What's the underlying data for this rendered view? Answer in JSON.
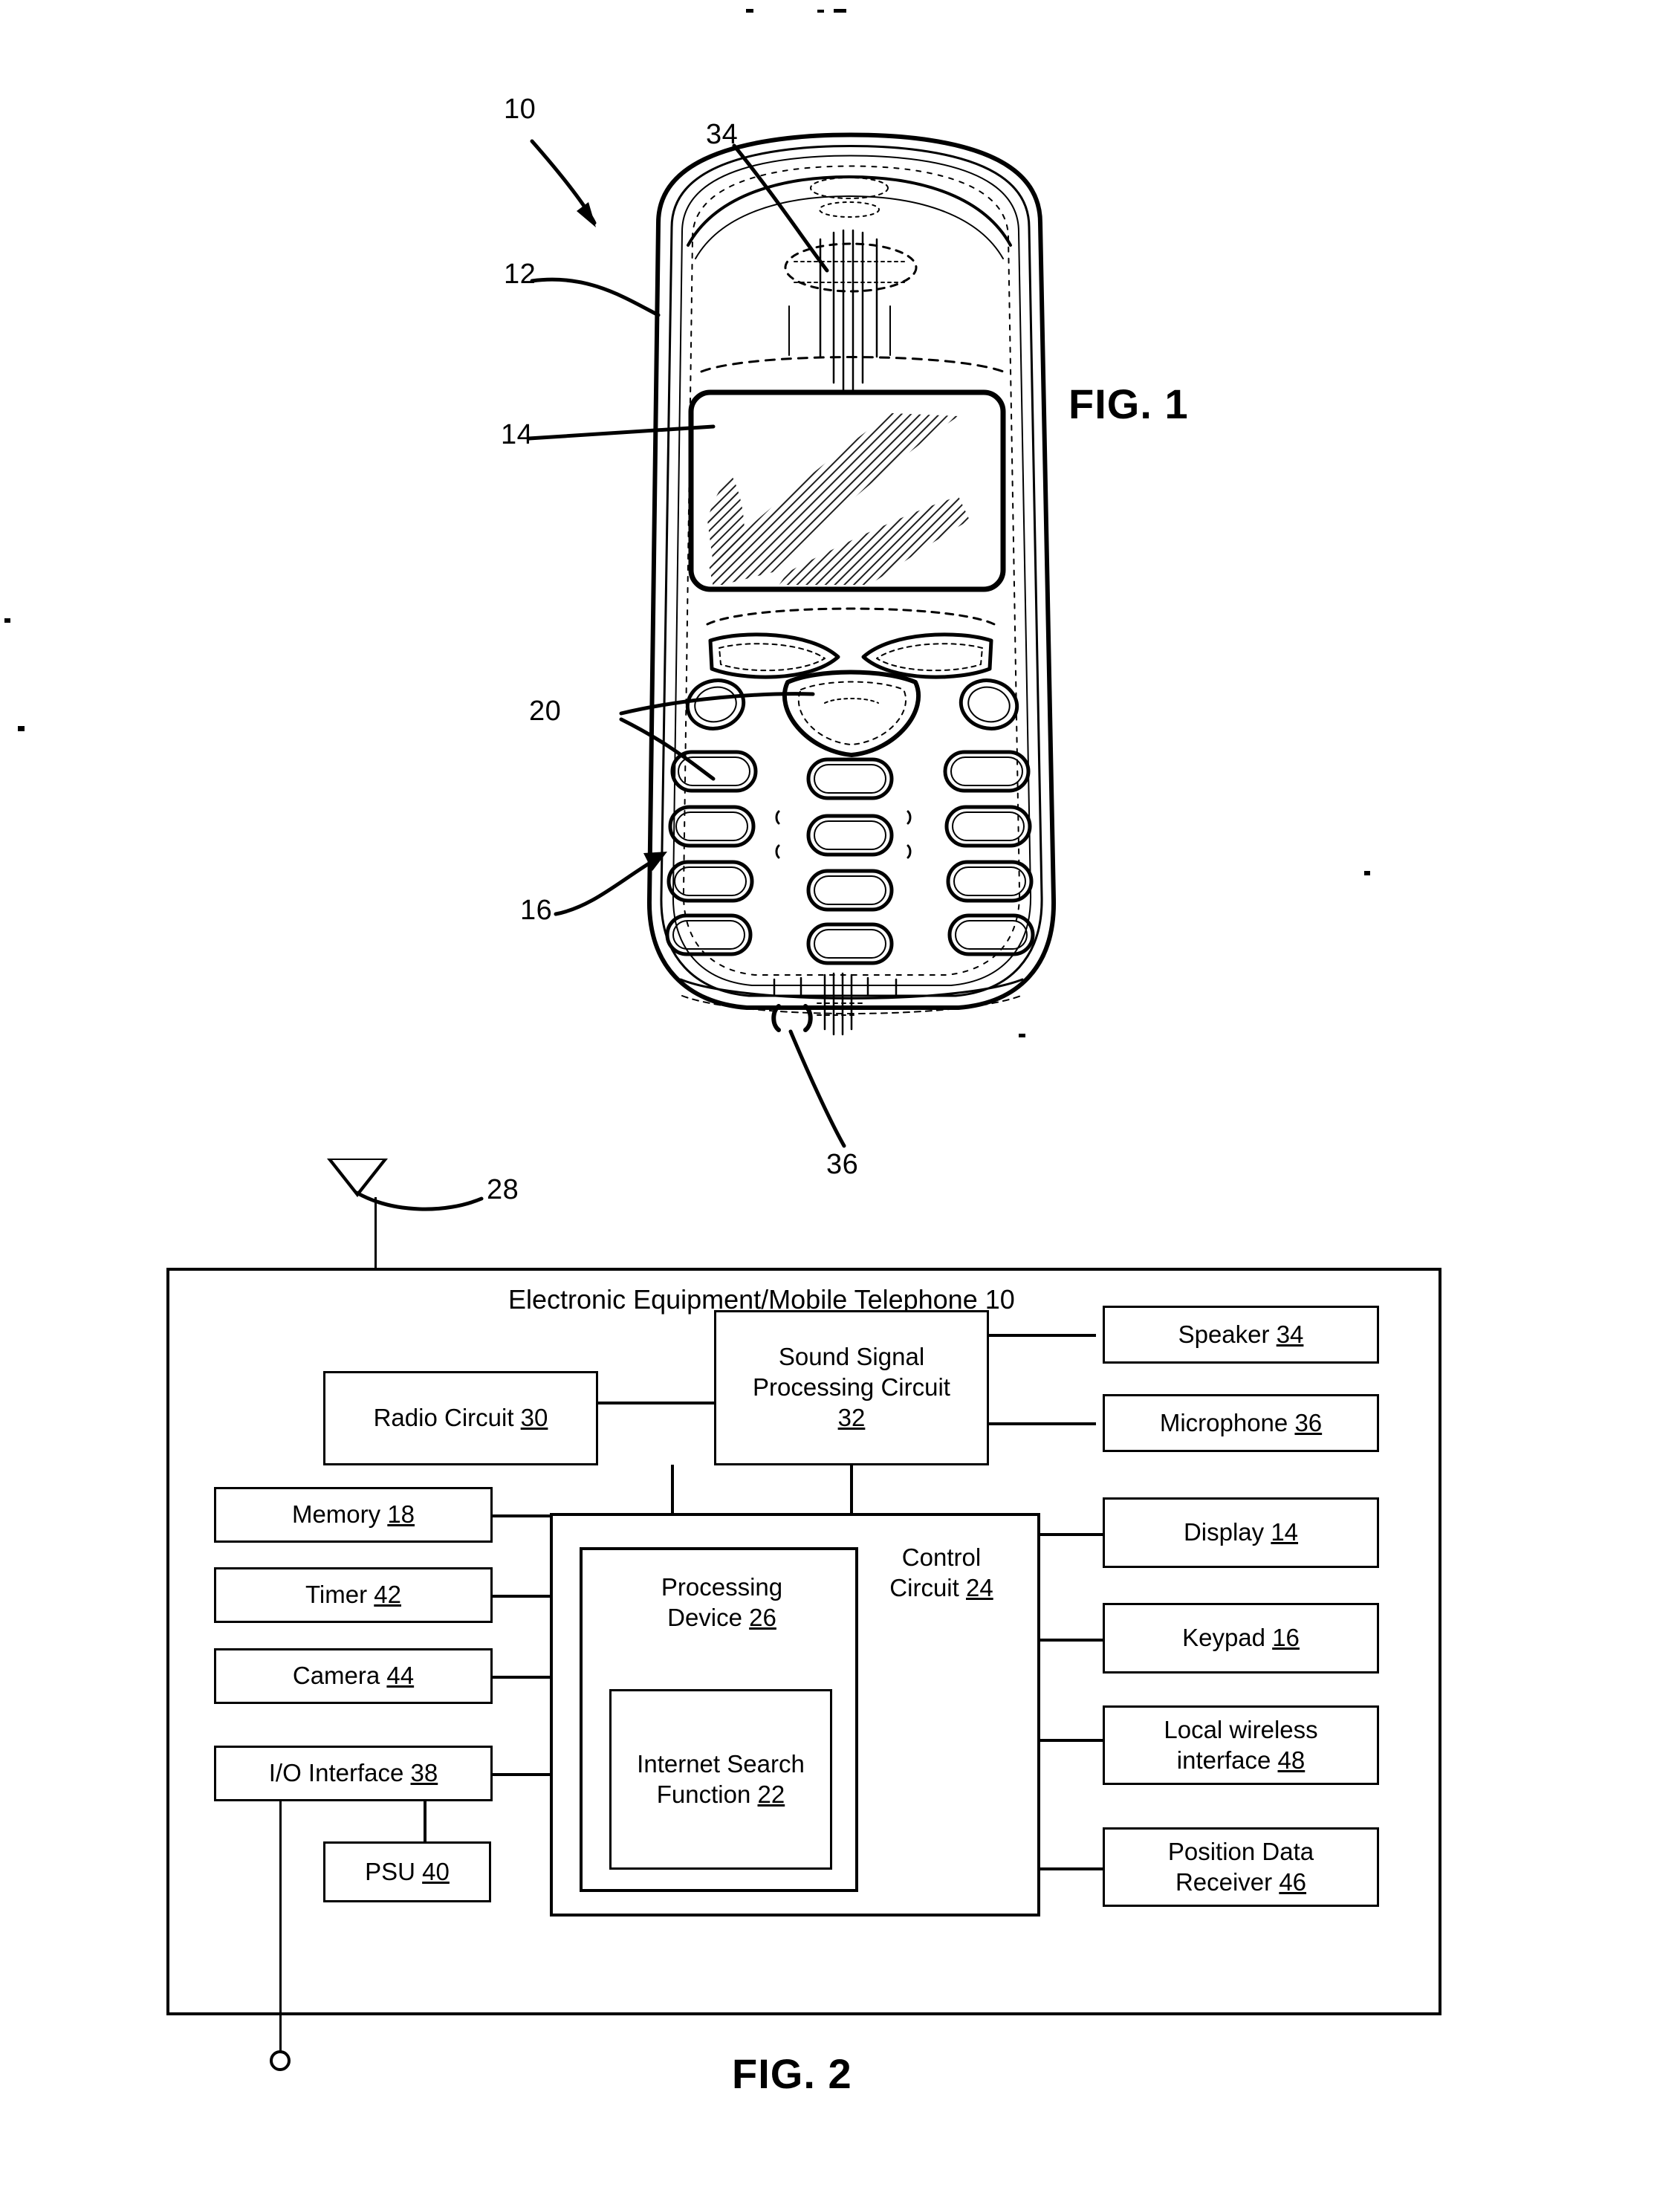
{
  "document": {
    "kind": "patent-drawing-sheet",
    "figures": [
      "FIG. 1",
      "FIG. 2"
    ]
  },
  "fig1": {
    "caption": "FIG. 1",
    "subject": "mobile telephone handset front view",
    "callouts": [
      {
        "num": "10",
        "meaning": "electronic equipment / mobile telephone"
      },
      {
        "num": "12",
        "meaning": "housing"
      },
      {
        "num": "14",
        "meaning": "display"
      },
      {
        "num": "34",
        "meaning": "speaker"
      },
      {
        "num": "20",
        "meaning": "keys"
      },
      {
        "num": "16",
        "meaning": "keypad"
      },
      {
        "num": "36",
        "meaning": "microphone"
      }
    ]
  },
  "fig2": {
    "caption": "FIG. 2",
    "title_text": "Electronic Equipment/Mobile Telephone",
    "title_num": "10",
    "antenna_label": "28",
    "blocks": [
      {
        "id": "radio",
        "line1": "Radio Circuit",
        "line2": "",
        "num": "30"
      },
      {
        "id": "sound",
        "line1": "Sound Signal",
        "line2": "Processing Circuit",
        "num": "32"
      },
      {
        "id": "speaker",
        "line1": "Speaker",
        "line2": "",
        "num": "34"
      },
      {
        "id": "micro",
        "line1": "Microphone",
        "line2": "",
        "num": "36"
      },
      {
        "id": "memory",
        "line1": "Memory",
        "line2": "",
        "num": "18"
      },
      {
        "id": "timer",
        "line1": "Timer",
        "line2": "",
        "num": "42"
      },
      {
        "id": "camera",
        "line1": "Camera",
        "line2": "",
        "num": "44"
      },
      {
        "id": "io",
        "line1": "I/O Interface",
        "line2": "",
        "num": "38"
      },
      {
        "id": "psu",
        "line1": "PSU",
        "line2": "",
        "num": "40"
      },
      {
        "id": "control",
        "line1": "Control",
        "line2": "Circuit",
        "num": "24"
      },
      {
        "id": "processing",
        "line1": "Processing",
        "line2": "Device",
        "num": "26"
      },
      {
        "id": "search",
        "line1": "Internet Search",
        "line2": "Function",
        "num": "22"
      },
      {
        "id": "display",
        "line1": "Display",
        "line2": "",
        "num": "14"
      },
      {
        "id": "keypad",
        "line1": "Keypad",
        "line2": "",
        "num": "16"
      },
      {
        "id": "localwl",
        "line1": "Local wireless",
        "line2": "interface",
        "num": "48"
      },
      {
        "id": "posdata",
        "line1": "Position Data",
        "line2": "Receiver",
        "num": "46"
      }
    ]
  },
  "colors": {
    "ink": "#000000",
    "paper": "#ffffff"
  }
}
